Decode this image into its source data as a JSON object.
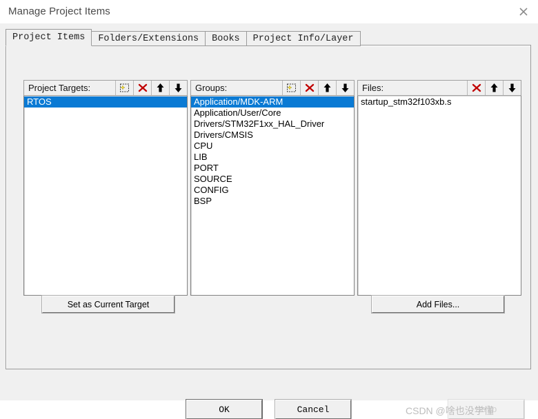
{
  "window": {
    "title": "Manage Project Items",
    "close_icon": "close-icon"
  },
  "tabs": [
    {
      "label": "Project Items",
      "active": true
    },
    {
      "label": "Folders/Extensions",
      "active": false
    },
    {
      "label": "Books",
      "active": false
    },
    {
      "label": "Project Info/Layer",
      "active": false
    }
  ],
  "columns": {
    "targets": {
      "header": "Project Targets:",
      "tools": [
        "new-item-icon",
        "delete-icon",
        "move-up-icon",
        "move-down-icon"
      ],
      "items": [
        {
          "label": "RTOS",
          "selected": true
        }
      ]
    },
    "groups": {
      "header": "Groups:",
      "tools": [
        "new-item-icon",
        "delete-icon",
        "move-up-icon",
        "move-down-icon"
      ],
      "items": [
        {
          "label": "Application/MDK-ARM",
          "selected": true
        },
        {
          "label": "Application/User/Core",
          "selected": false
        },
        {
          "label": "Drivers/STM32F1xx_HAL_Driver",
          "selected": false
        },
        {
          "label": "Drivers/CMSIS",
          "selected": false
        },
        {
          "label": "CPU",
          "selected": false
        },
        {
          "label": "LIB",
          "selected": false
        },
        {
          "label": "PORT",
          "selected": false
        },
        {
          "label": "SOURCE",
          "selected": false
        },
        {
          "label": "CONFIG",
          "selected": false
        },
        {
          "label": "BSP",
          "selected": false
        }
      ]
    },
    "files": {
      "header": "Files:",
      "tools": [
        "delete-icon",
        "move-up-icon",
        "move-down-icon"
      ],
      "items": [
        {
          "label": "startup_stm32f103xb.s",
          "selected": false
        }
      ]
    }
  },
  "buttons": {
    "set_as_current_target": "Set as Current Target",
    "add_files": "Add Files...",
    "ok": "OK",
    "cancel": "Cancel",
    "help": "Help"
  },
  "watermark": "CSDN @啥也没学懂",
  "colors": {
    "selection": "#0a7ad4",
    "dialog_face": "#f0f0f0",
    "delete_icon": "#c00000",
    "title_text": "#4a4a4a"
  }
}
